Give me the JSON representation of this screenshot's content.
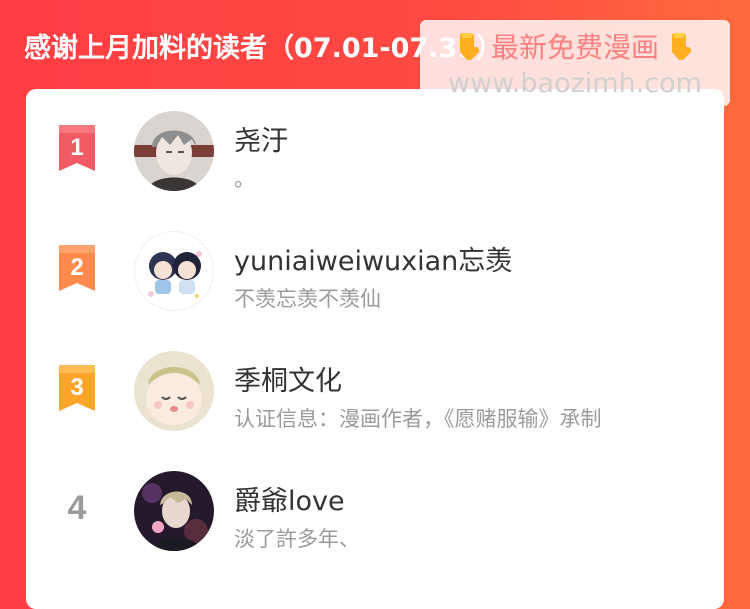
{
  "header": {
    "title": "感谢上月加料的读者（07.01-07.31）"
  },
  "watermark": {
    "line1": "最新免费漫画",
    "line2": "www.baozimh.com",
    "left_icon": "pointing-down-hand-icon",
    "right_icon": "pointing-down-hand-icon"
  },
  "colors": {
    "background": "#ff4a42",
    "rank1": "#f25b63",
    "rank2": "#ff8a4c",
    "rank3": "#ffa42a",
    "rank_plain": "#9a9a9a"
  },
  "readers": [
    {
      "rank": "1",
      "name": "尧汙",
      "desc": "。",
      "avatar_icon": "avatar-gray-hair-boy-icon"
    },
    {
      "rank": "2",
      "name": "yuniaiweiwuxian忘羡",
      "desc": "不羡忘羡不羡仙",
      "avatar_icon": "avatar-chibi-pair-icon"
    },
    {
      "rank": "3",
      "name": "季桐文化",
      "desc": "认证信息：漫画作者，《愿赌服输》承制",
      "avatar_icon": "avatar-baby-face-icon"
    },
    {
      "rank": "4",
      "name": "爵爺love",
      "desc": "淡了許多年、",
      "avatar_icon": "avatar-dark-boy-icon"
    }
  ]
}
